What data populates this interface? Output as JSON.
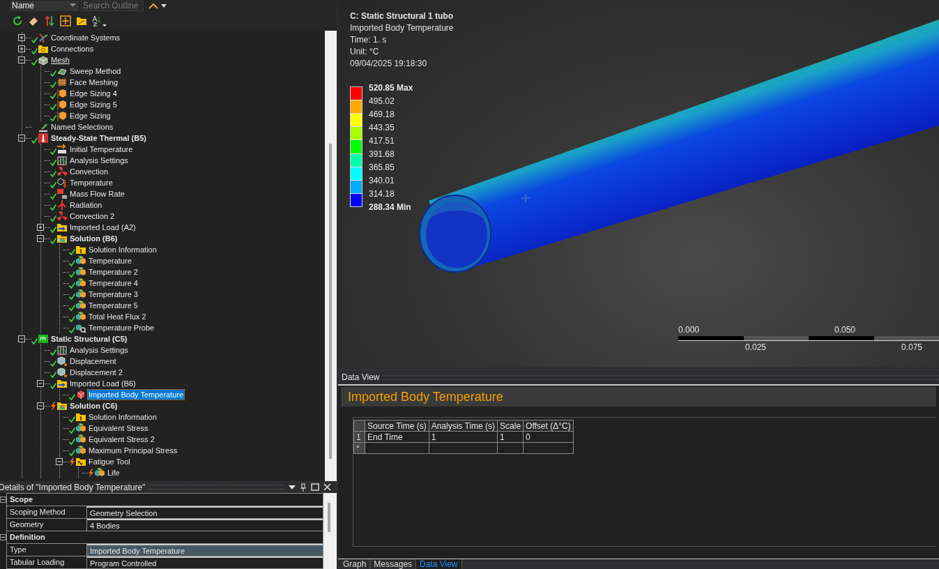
{
  "outline_toolbar": {
    "name_filter": "Name",
    "search": {
      "placeholder": "Search Outline"
    }
  },
  "tree": [
    {
      "label": "Coordinate Systems",
      "kind": "axes",
      "solved": true,
      "expanded": false,
      "selected": false
    },
    {
      "label": "Connections",
      "kind": "connections",
      "solved": true,
      "expanded": false,
      "selected": false
    },
    {
      "label": "Mesh",
      "kind": "mesh",
      "solved": true,
      "expanded": true,
      "underlined": true,
      "selected": false,
      "children": [
        {
          "label": "Sweep Method",
          "kind": "sweep",
          "solved": true,
          "selected": false
        },
        {
          "label": "Face Meshing",
          "kind": "grid",
          "solved": true,
          "selected": false
        },
        {
          "label": "Edge Sizing 4",
          "kind": "sizing",
          "solved": true,
          "selected": false
        },
        {
          "label": "Edge Sizing 5",
          "kind": "sizing",
          "solved": true,
          "selected": false
        },
        {
          "label": "Edge Sizing",
          "kind": "sizing",
          "solved": true,
          "selected": false
        }
      ]
    },
    {
      "label": "Named Selections",
      "kind": "tag",
      "selected": false
    },
    {
      "label": "Steady-State Thermal (B5)",
      "kind": "thermal",
      "solved": true,
      "expanded": true,
      "bold": true,
      "selected": false,
      "children": [
        {
          "label": "Initial Temperature",
          "kind": "arrow",
          "solved": true,
          "selected": false
        },
        {
          "label": "Analysis Settings",
          "kind": "settings",
          "solved": true,
          "selected": false
        },
        {
          "label": "Convection",
          "kind": "fan",
          "solved": true,
          "selected": false
        },
        {
          "label": "Temperature",
          "kind": "thermo-cube",
          "solved": true,
          "selected": false
        },
        {
          "label": "Mass Flow Rate",
          "kind": "weight",
          "solved": true,
          "selected": false
        },
        {
          "label": "Radiation",
          "kind": "radiation",
          "solved": true,
          "selected": false
        },
        {
          "label": "Convection 2",
          "kind": "fan",
          "solved": true,
          "selected": false
        },
        {
          "label": "Imported Load (A2)",
          "kind": "import",
          "solved": true,
          "expanded": false,
          "selected": false
        },
        {
          "label": "Solution (B6)",
          "kind": "solution",
          "solved": true,
          "expanded": true,
          "bold": true,
          "selected": false,
          "children": [
            {
              "label": "Solution Information",
              "kind": "info",
              "solved": true,
              "selected": false
            },
            {
              "label": "Temperature",
              "kind": "result",
              "solved": true,
              "selected": false
            },
            {
              "label": "Temperature 2",
              "kind": "result",
              "solved": true,
              "selected": false
            },
            {
              "label": "Temperature 4",
              "kind": "result",
              "solved": true,
              "selected": false
            },
            {
              "label": "Temperature 3",
              "kind": "result",
              "solved": true,
              "selected": false
            },
            {
              "label": "Temperature 5",
              "kind": "result",
              "solved": true,
              "selected": false
            },
            {
              "label": "Total Heat Flux 2",
              "kind": "result",
              "solved": true,
              "selected": false
            },
            {
              "label": "Temperature Probe",
              "kind": "probe",
              "solved": true,
              "selected": false
            }
          ]
        }
      ]
    },
    {
      "label": "Static Structural (C5)",
      "kind": "structural",
      "solved": true,
      "expanded": true,
      "bold": true,
      "selected": false,
      "children": [
        {
          "label": "Analysis Settings",
          "kind": "settings",
          "solved": true,
          "selected": false
        },
        {
          "label": "Displacement",
          "kind": "support",
          "solved": true,
          "selected": false
        },
        {
          "label": "Displacement 2",
          "kind": "support",
          "solved": true,
          "selected": false
        },
        {
          "label": "Imported Load (B6)",
          "kind": "import",
          "solved": true,
          "expanded": true,
          "selected": false,
          "children": [
            {
              "label": "Imported Body Temperature",
              "kind": "hot-cube",
              "solved": true,
              "selected": true
            }
          ]
        },
        {
          "label": "Solution (C6)",
          "kind": "solution",
          "solved": false,
          "expanded": true,
          "bold": true,
          "selected": false,
          "children": [
            {
              "label": "Solution Information",
              "kind": "info",
              "solved": true,
              "selected": false
            },
            {
              "label": "Equivalent Stress",
              "kind": "result",
              "solved": true,
              "selected": false
            },
            {
              "label": "Equivalent Stress 2",
              "kind": "result",
              "solved": true,
              "selected": false
            },
            {
              "label": "Maximum Principal Stress",
              "kind": "result",
              "solved": true,
              "selected": false
            },
            {
              "label": "Fatigue Tool",
              "kind": "fatigue",
              "solved": false,
              "expanded": true,
              "selected": false,
              "children": [
                {
                  "label": "Life",
                  "kind": "result",
                  "solved": false,
                  "selected": false
                }
              ]
            }
          ]
        }
      ]
    }
  ],
  "details": {
    "title": "Details of \"Imported Body Temperature\"",
    "rows": [
      {
        "kind": "section",
        "label": "Scope",
        "expanded": true
      },
      {
        "kind": "field",
        "label": "Scoping Method",
        "value": "Geometry Selection",
        "selected": false
      },
      {
        "kind": "field",
        "label": "Geometry",
        "value": "4 Bodies",
        "selected": false
      },
      {
        "kind": "section",
        "label": "Definition",
        "expanded": true
      },
      {
        "kind": "field",
        "label": "Type",
        "value": "Imported Body Temperature",
        "selected": true
      },
      {
        "kind": "field",
        "label": "Tabular Loading",
        "value": "Program Controlled",
        "selected": false
      }
    ]
  },
  "viewport": {
    "title": "C: Static Structural 1 tubo",
    "lines": [
      "Imported Body Temperature",
      "Time: 1. s",
      "Unit: °C",
      "09/04/2025 19:18:30"
    ],
    "legend": {
      "max_label": "520.85 Max",
      "min_label": "288.34 Min",
      "values": [
        "495.02",
        "469.18",
        "443.35",
        "417.51",
        "391.68",
        "365.85",
        "340.01",
        "314.18"
      ],
      "bands": [
        {
          "color": "#ff0000"
        },
        {
          "color": "#ffaa00"
        },
        {
          "color": "#ffff00"
        },
        {
          "color": "#aaff00"
        },
        {
          "color": "#00ff00"
        },
        {
          "color": "#00ffaa"
        },
        {
          "color": "#00ffff"
        },
        {
          "color": "#00aaff"
        },
        {
          "color": "#0000ff"
        }
      ]
    },
    "scale": {
      "top_labels": [
        "0.000",
        "0.050"
      ],
      "bottom_labels": [
        "0.025",
        "0.075"
      ]
    }
  },
  "data_view": {
    "header": "Data View",
    "title": "Imported Body Temperature",
    "columns": [
      "Source Time (s)",
      "Analysis Time (s)",
      "Scale",
      "Offset (Δ°C)"
    ],
    "rows": [
      {
        "index": "1",
        "cells": [
          "End Time",
          "1",
          "1",
          "0"
        ]
      }
    ],
    "new_row_marker": "*"
  },
  "bottom_tabs": [
    {
      "label": "Graph",
      "selected": false
    },
    {
      "label": "Messages",
      "selected": false
    },
    {
      "label": "Data View",
      "selected": true
    }
  ]
}
